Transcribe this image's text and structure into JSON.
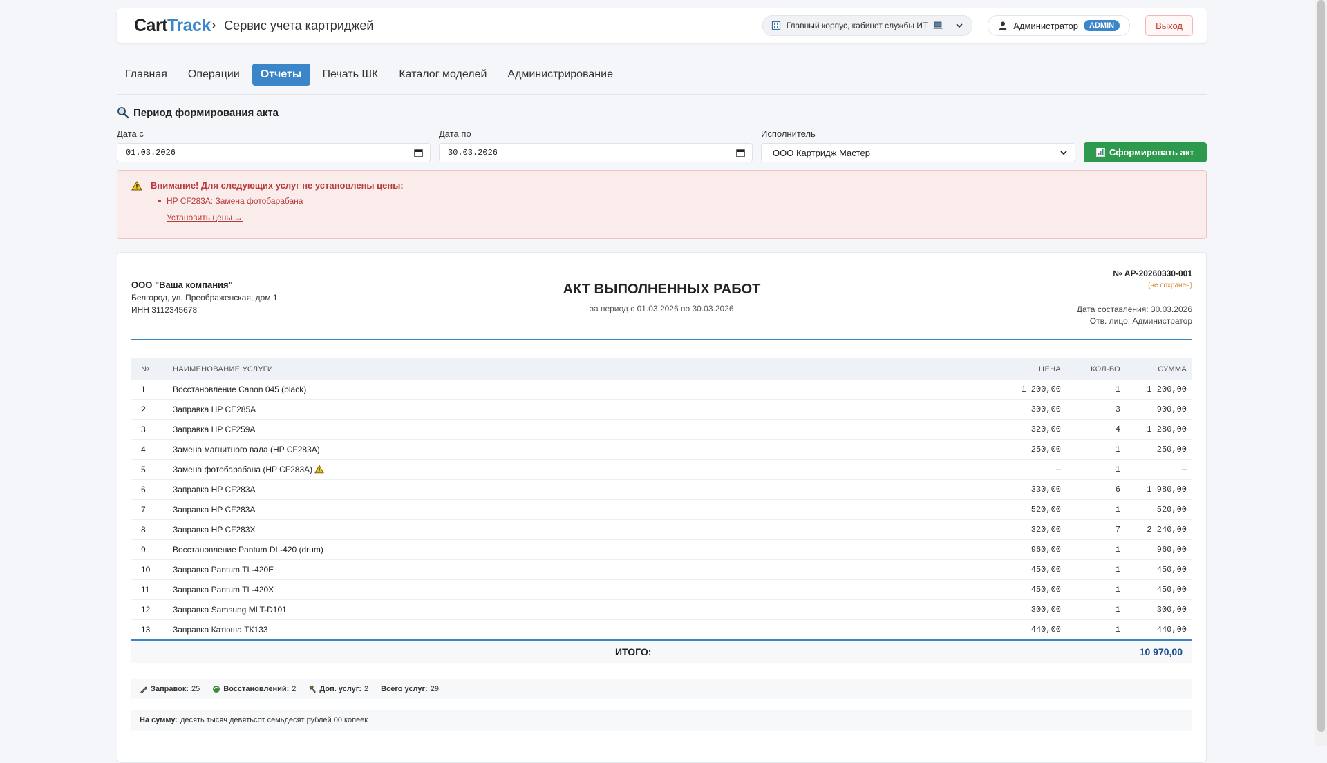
{
  "header": {
    "brand_main": "Cart",
    "brand_accent": "Track",
    "brand_chevron": "›",
    "app_title": "Сервис учета картриджей",
    "location_label": "Главный корпус, кабинет службы ИТ",
    "user_name": "Администратор",
    "user_role_badge": "ADMIN",
    "logout_label": "Выход"
  },
  "tabs": [
    {
      "label": "Главная",
      "active": false
    },
    {
      "label": "Операции",
      "active": false
    },
    {
      "label": "Отчеты",
      "active": true
    },
    {
      "label": "Печать ШК",
      "active": false
    },
    {
      "label": "Каталог моделей",
      "active": false
    },
    {
      "label": "Администрирование",
      "active": false
    }
  ],
  "filter": {
    "section_title": "Период формирования акта",
    "date_from_label": "Дата с",
    "date_from_value": "01.03.2026",
    "date_to_label": "Дата по",
    "date_to_value": "30.03.2026",
    "executor_label": "Исполнитель",
    "executor_value": "ООО Картридж Мастер",
    "submit_label": "Сформировать акт"
  },
  "warning": {
    "title": "Внимание! Для следующих услуг не установлены цены:",
    "items": [
      "HP CF283A: Замена фотобарабана"
    ],
    "link_label": "Установить цены →"
  },
  "act": {
    "company_name": "ООО \"Ваша компания\"",
    "company_address": "Белгород, ул. Преображенская, дом 1",
    "company_inn": "ИНН 3112345678",
    "title": "АКТ ВЫПОЛНЕННЫХ РАБОТ",
    "period": "за период с 01.03.2026 по 30.03.2026",
    "number": "№ АР-20260330-001",
    "save_status": "(не сохранен)",
    "date_label": "Дата составления: 30.03.2026",
    "responsible": "Отв. лицо: Администратор",
    "columns": {
      "num": "№",
      "name": "НАИМЕНОВАНИЕ УСЛУГИ",
      "price": "ЦЕНА",
      "qty": "КОЛ-ВО",
      "sum": "СУММА"
    },
    "rows": [
      {
        "num": "1",
        "name": "Восстановление Canon 045 (black)",
        "price": "1 200,00",
        "qty": "1",
        "sum": "1 200,00",
        "warn": false
      },
      {
        "num": "2",
        "name": "Заправка HP CE285A",
        "price": "300,00",
        "qty": "3",
        "sum": "900,00",
        "warn": false
      },
      {
        "num": "3",
        "name": "Заправка HP CF259A",
        "price": "320,00",
        "qty": "4",
        "sum": "1 280,00",
        "warn": false
      },
      {
        "num": "4",
        "name": "Замена магнитного вала (HP CF283A)",
        "price": "250,00",
        "qty": "1",
        "sum": "250,00",
        "warn": false
      },
      {
        "num": "5",
        "name": "Замена фотобарабана (HP CF283A)",
        "price": "—",
        "qty": "1",
        "sum": "—",
        "warn": true
      },
      {
        "num": "6",
        "name": "Заправка HP CF283A",
        "price": "330,00",
        "qty": "6",
        "sum": "1 980,00",
        "warn": false
      },
      {
        "num": "7",
        "name": "Заправка HP CF283A",
        "price": "520,00",
        "qty": "1",
        "sum": "520,00",
        "warn": false
      },
      {
        "num": "8",
        "name": "Заправка HP CF283X",
        "price": "320,00",
        "qty": "7",
        "sum": "2 240,00",
        "warn": false
      },
      {
        "num": "9",
        "name": "Восстановление Pantum DL-420 (drum)",
        "price": "960,00",
        "qty": "1",
        "sum": "960,00",
        "warn": false
      },
      {
        "num": "10",
        "name": "Заправка Pantum TL-420E",
        "price": "450,00",
        "qty": "1",
        "sum": "450,00",
        "warn": false
      },
      {
        "num": "11",
        "name": "Заправка Pantum TL-420X",
        "price": "450,00",
        "qty": "1",
        "sum": "450,00",
        "warn": false
      },
      {
        "num": "12",
        "name": "Заправка Samsung MLT-D101",
        "price": "300,00",
        "qty": "1",
        "sum": "300,00",
        "warn": false
      },
      {
        "num": "13",
        "name": "Заправка Катюша ТК133",
        "price": "440,00",
        "qty": "1",
        "sum": "440,00",
        "warn": false
      }
    ],
    "total_label": "ИТОГО:",
    "total_value": "10 970,00",
    "stats": {
      "refills_label": "Заправок:",
      "refills_value": "25",
      "restores_label": "Восстановлений:",
      "restores_value": "2",
      "extra_label": "Доп. услуг:",
      "extra_value": "2",
      "total_label": "Всего услуг:",
      "total_value": "29"
    },
    "words_label": "На сумму:",
    "words_value": "десять тысяч девятьсот семьдесят рублей 00 копеек"
  },
  "colors": {
    "accent": "#3a86c8",
    "success": "#2e9a4e",
    "danger": "#c0392b",
    "warning_bg": "#fbecec"
  }
}
